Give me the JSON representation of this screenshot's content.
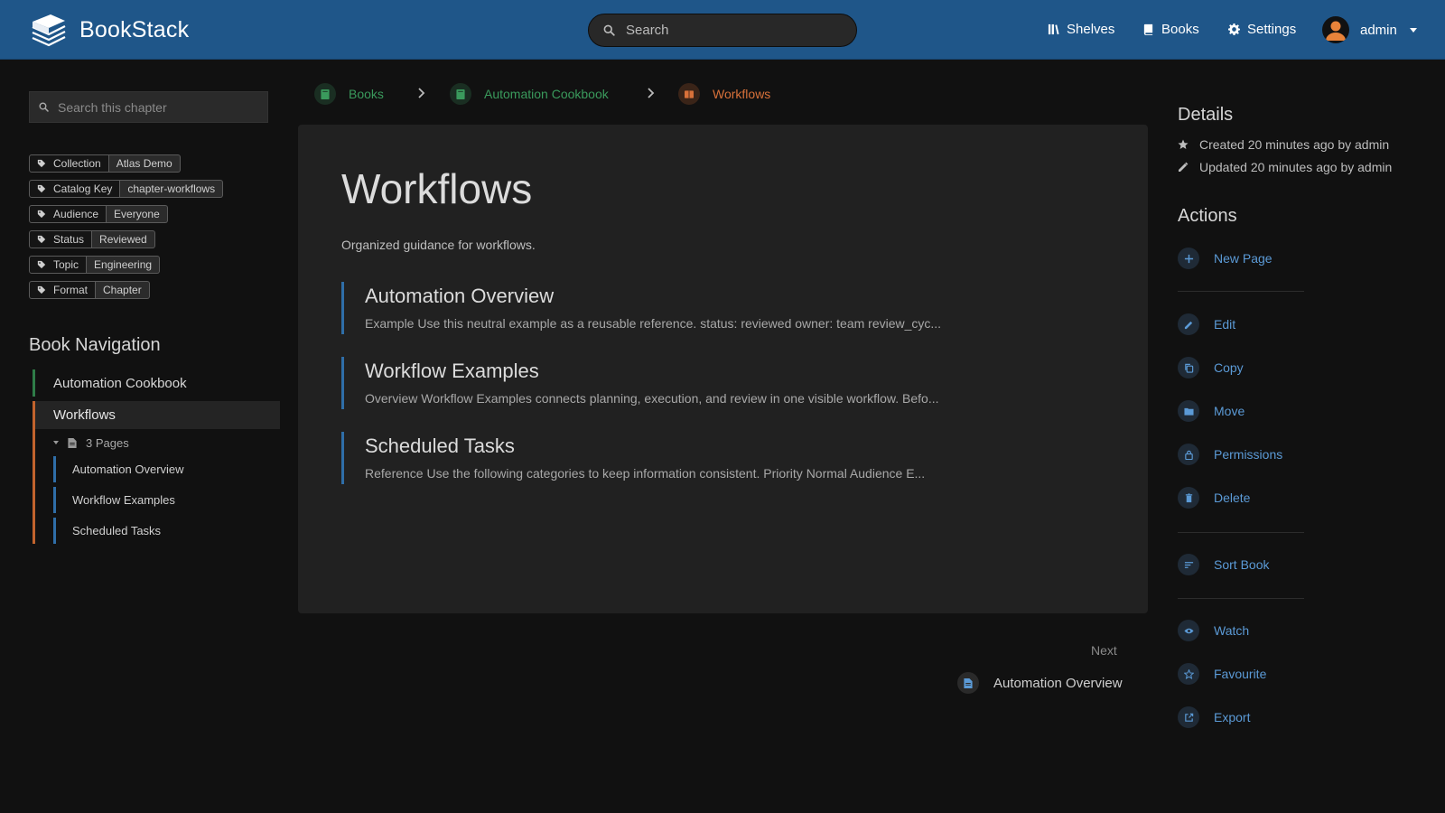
{
  "colors": {
    "header_bg": "#1f5689",
    "book_green": "#3a9a5c",
    "chapter_orange": "#d8713a",
    "page_blue": "#2f6ea8",
    "action_blue": "#5b9ad6"
  },
  "header": {
    "app_name": "BookStack",
    "search_placeholder": "Search",
    "nav": [
      {
        "label": "Shelves",
        "icon": "shelves-icon"
      },
      {
        "label": "Books",
        "icon": "books-icon"
      },
      {
        "label": "Settings",
        "icon": "gear-icon"
      }
    ],
    "user_name": "admin"
  },
  "sidebar": {
    "search_placeholder": "Search this chapter",
    "tags": [
      {
        "name": "Collection",
        "value": "Atlas Demo"
      },
      {
        "name": "Catalog Key",
        "value": "chapter-workflows"
      },
      {
        "name": "Audience",
        "value": "Everyone"
      },
      {
        "name": "Status",
        "value": "Reviewed"
      },
      {
        "name": "Topic",
        "value": "Engineering"
      },
      {
        "name": "Format",
        "value": "Chapter"
      }
    ],
    "book_nav_title": "Book Navigation",
    "book": "Automation Cookbook",
    "chapter": "Workflows",
    "pages_toggle": "3 Pages",
    "pages": [
      "Automation Overview",
      "Workflow Examples",
      "Scheduled Tasks"
    ]
  },
  "breadcrumb": [
    {
      "label": "Books",
      "type": "books"
    },
    {
      "label": "Automation Cookbook",
      "type": "book"
    },
    {
      "label": "Workflows",
      "type": "chapter"
    }
  ],
  "main": {
    "title": "Workflows",
    "description": "Organized guidance for workflows.",
    "entries": [
      {
        "title": "Automation Overview",
        "excerpt": "Example Use this neutral example as a reusable reference. status: reviewed owner: team review_cyc..."
      },
      {
        "title": "Workflow Examples",
        "excerpt": "Overview Workflow Examples connects planning, execution, and review in one visible workflow. Befo..."
      },
      {
        "title": "Scheduled Tasks",
        "excerpt": "Reference Use the following categories to keep information consistent. Priority Normal Audience E..."
      }
    ],
    "next_label": "Next",
    "next_link": "Automation Overview"
  },
  "details": {
    "title": "Details",
    "created": "Created 20 minutes ago by admin",
    "updated": "Updated 20 minutes ago by admin"
  },
  "actions": {
    "title": "Actions",
    "items": [
      {
        "label": "New Page",
        "icon": "plus-icon"
      },
      {
        "label": "Edit",
        "icon": "pencil-icon"
      },
      {
        "label": "Copy",
        "icon": "copy-icon"
      },
      {
        "label": "Move",
        "icon": "folder-icon"
      },
      {
        "label": "Permissions",
        "icon": "lock-icon"
      },
      {
        "label": "Delete",
        "icon": "trash-icon"
      },
      {
        "label": "Sort Book",
        "icon": "sort-icon"
      },
      {
        "label": "Watch",
        "icon": "eye-icon"
      },
      {
        "label": "Favourite",
        "icon": "star-icon"
      },
      {
        "label": "Export",
        "icon": "export-icon"
      }
    ]
  }
}
